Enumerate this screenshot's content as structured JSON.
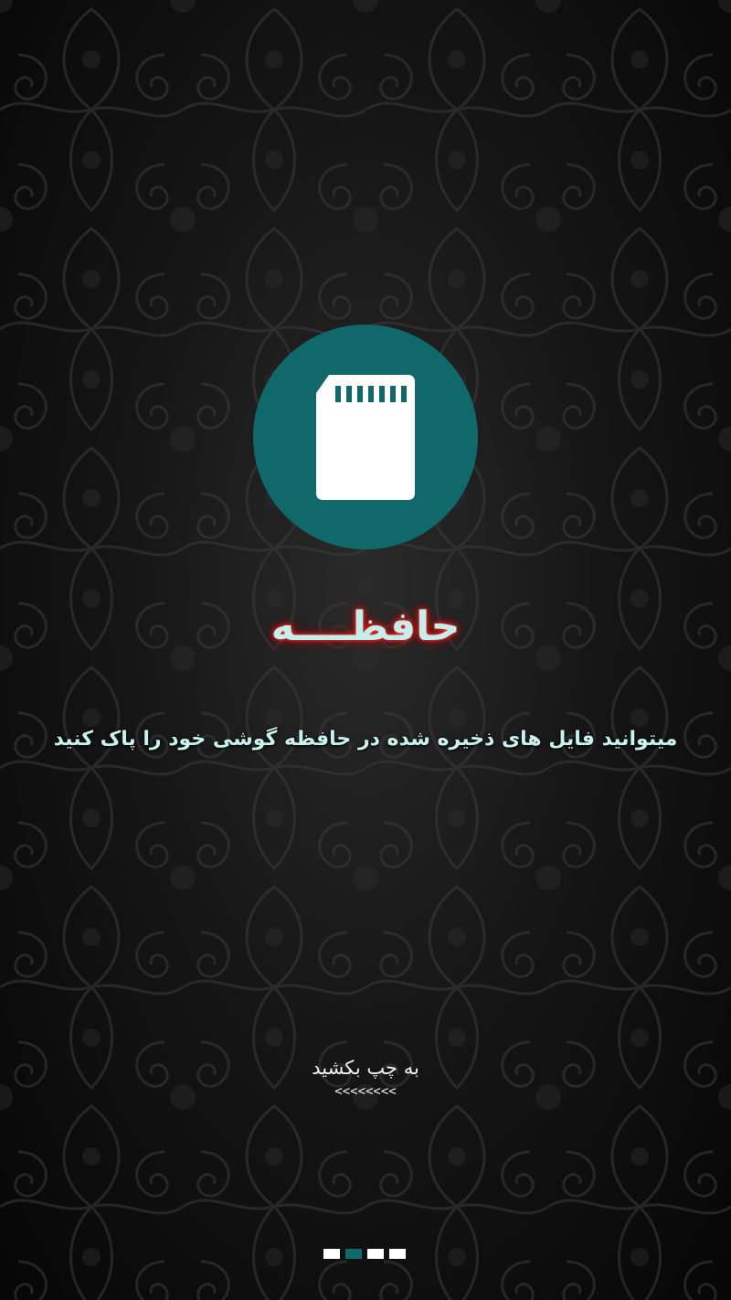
{
  "onboarding": {
    "title": "حافظــــه",
    "description": "میتوانید فایل های ذخیره شده در حافظه گوشی خود را پاک کنید",
    "swipe_hint": "به چپ بکشید",
    "swipe_arrows": "<<<<<<<<"
  },
  "feature_icon": {
    "icon": "sd-card-icon",
    "circle_color": "#11686a",
    "icon_color": "#ffffff"
  },
  "pagination": {
    "total_pages": 4,
    "current_page": 2,
    "active_color": "#11686a",
    "inactive_color": "#ffffff"
  },
  "colors": {
    "title_text": "#c3efec",
    "title_glow": "#ff2a2a",
    "description_text": "#c8f2ee",
    "hint_text": "#f2f2f2"
  }
}
